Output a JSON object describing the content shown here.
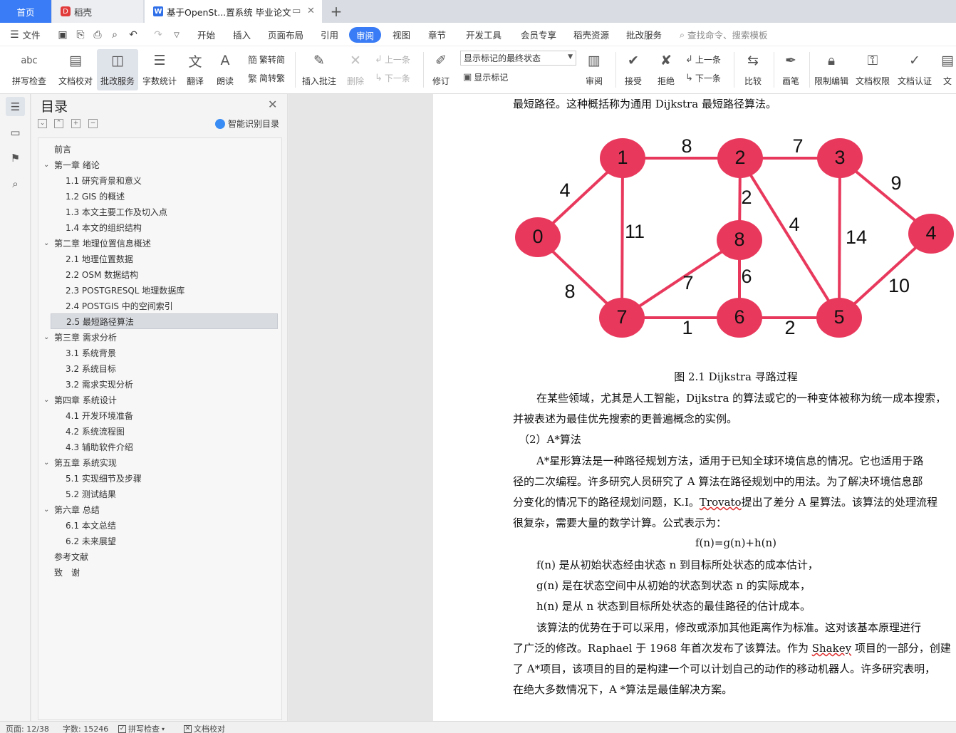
{
  "tabs": {
    "home": "首页",
    "daoke": "稻壳",
    "doc": "基于OpenSt...置系统 毕业论文",
    "add": "+"
  },
  "menu": {
    "file": "文件",
    "items": [
      "开始",
      "插入",
      "页面布局",
      "引用",
      "审阅",
      "视图",
      "章节",
      "开发工具",
      "会员专享",
      "稻壳资源",
      "批改服务"
    ],
    "active": "审阅",
    "search_placeholder": "查找命令、搜索模板"
  },
  "toolbar": {
    "spellcheck": "拼写检查",
    "doc_proofread": "文档校对",
    "revise_service": "批改服务",
    "word_count": "字数统计",
    "translate": "翻译",
    "read_aloud": "朗读",
    "trad_to_simp": "繁转简",
    "simp_to_trad": "简转繁",
    "insert_comment": "插入批注",
    "delete": "删除",
    "prev_item": "上一条",
    "next_item": "下一条",
    "revise": "修订",
    "display_state": "显示标记的最终状态",
    "show_marks": "显示标记",
    "review": "审阅",
    "accept": "接受",
    "reject": "拒绝",
    "prev_change": "上一条",
    "next_change": "下一条",
    "compare": "比较",
    "pen": "画笔",
    "restrict_edit": "限制编辑",
    "doc_permission": "文档权限",
    "doc_auth": "文档认证",
    "more": "文"
  },
  "toc": {
    "title": "目录",
    "smart": "智能识别目录",
    "items": [
      {
        "text": "前言",
        "level": 1,
        "expanded": false
      },
      {
        "text": "第一章 绪论",
        "level": 1,
        "expanded": true
      },
      {
        "text": "1.1 研究背景和意义",
        "level": 2
      },
      {
        "text": "1.2 GIS 的概述",
        "level": 2
      },
      {
        "text": "1.3 本文主要工作及切入点",
        "level": 2
      },
      {
        "text": "1.4 本文的组织结构",
        "level": 2
      },
      {
        "text": "第二章 地理位置信息概述",
        "level": 1,
        "expanded": true
      },
      {
        "text": "2.1 地理位置数据",
        "level": 2
      },
      {
        "text": "2.2 OSM 数据结构",
        "level": 2
      },
      {
        "text": "2.3 POSTGRESQL 地理数据库",
        "level": 2
      },
      {
        "text": "2.4 POSTGIS 中的空间索引",
        "level": 2
      },
      {
        "text": "2.5 最短路径算法",
        "level": 2,
        "selected": true
      },
      {
        "text": "第三章 需求分析",
        "level": 1,
        "expanded": true
      },
      {
        "text": "3.1 系统背景",
        "level": 2
      },
      {
        "text": "3.2 系统目标",
        "level": 2
      },
      {
        "text": "3.2 需求实现分析",
        "level": 2
      },
      {
        "text": "第四章 系统设计",
        "level": 1,
        "expanded": true
      },
      {
        "text": "4.1 开发环境准备",
        "level": 2
      },
      {
        "text": "4.2 系统流程图",
        "level": 2
      },
      {
        "text": "4.3 辅助软件介绍",
        "level": 2
      },
      {
        "text": "第五章 系统实现",
        "level": 1,
        "expanded": true
      },
      {
        "text": "5.1 实现细节及步骤",
        "level": 2
      },
      {
        "text": "5.2 测试结果",
        "level": 2
      },
      {
        "text": "第六章 总结",
        "level": 1,
        "expanded": true
      },
      {
        "text": "6.1 本文总结",
        "level": 2
      },
      {
        "text": "6.2 未来展望",
        "level": 2
      },
      {
        "text": "参考文献",
        "level": 1,
        "expanded": false
      },
      {
        "text": "致　谢",
        "level": 1,
        "expanded": false
      }
    ]
  },
  "document": {
    "line_top": "最短路径。这种概括称为通用 Dijkstra 最短路径算法。",
    "graph": {
      "node_color": "#e8395d",
      "nodes": [
        "0",
        "1",
        "2",
        "3",
        "4",
        "5",
        "6",
        "7",
        "8"
      ],
      "edges": [
        {
          "from": "0",
          "to": "1",
          "weight": "4"
        },
        {
          "from": "0",
          "to": "7",
          "weight": "8"
        },
        {
          "from": "1",
          "to": "2",
          "weight": "8"
        },
        {
          "from": "1",
          "to": "7",
          "weight": "11"
        },
        {
          "from": "2",
          "to": "3",
          "weight": "7"
        },
        {
          "from": "2",
          "to": "8",
          "weight": "2"
        },
        {
          "from": "2",
          "to": "5",
          "weight": "4"
        },
        {
          "from": "3",
          "to": "4",
          "weight": "9"
        },
        {
          "from": "3",
          "to": "5",
          "weight": "14"
        },
        {
          "from": "4",
          "to": "5",
          "weight": "10"
        },
        {
          "from": "5",
          "to": "6",
          "weight": "2"
        },
        {
          "from": "6",
          "to": "7",
          "weight": "1"
        },
        {
          "from": "6",
          "to": "8",
          "weight": "6"
        },
        {
          "from": "7",
          "to": "8",
          "weight": "7"
        }
      ]
    },
    "caption": "图 2.1 Dijkstra 寻路过程",
    "p1": [
      "在某些领域，尤其是人工智能，Dijkstra 的算法或它的一种变体被称为统一成本搜索，",
      "并被表述为最佳优先搜索的更普遍概念的实例。"
    ],
    "heading": "（2）A*算法",
    "p2": [
      "A*星形算法是一种路径规划方法，适用于已知全球环境信息的情况。它也适用于路",
      "径的二次编程。许多研究人员研究了 A 算法在路径规划中的用法。为了解决环境信息部",
      "分变化的情况下的路径规划问题，K.I。",
      "Trovato",
      "提出了差分 A 星算法。该算法的处理流程",
      "很复杂，需要大量的数学计算。公式表示为："
    ],
    "formula": "f(n)=g(n)+h(n)",
    "defs": [
      "f(n) 是从初始状态经由状态 n 到目标所处状态的成本估计，",
      "g(n) 是在状态空间中从初始的状态到状态 n 的实际成本，",
      "h(n) 是从 n 状态到目标所处状态的最佳路径的估计成本。"
    ],
    "p3": [
      "该算法的优势在于可以采用，修改或添加其他距离作为标准。这对该基本原理进行",
      "了广泛的修改。Raphael 于 1968 年首次发布了该算法。作为 ",
      "Shakey",
      " 项目的一部分，创建",
      "了 A*项目，该项目的目的是构建一个可以计划自己的动作的移动机器人。许多研究表明，",
      "在绝大多数情况下，A *算法是最佳解决方案。"
    ]
  },
  "status": {
    "page": "页面: 12/38",
    "words": "字数: 15246",
    "spell": "拼写检查",
    "proof": "文档校对"
  }
}
